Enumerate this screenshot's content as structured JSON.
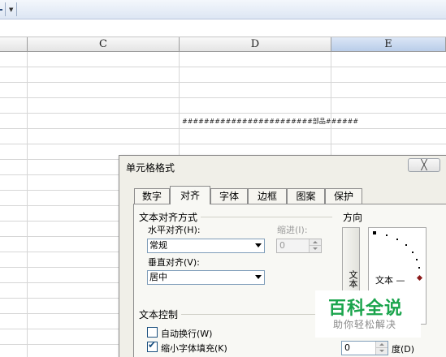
{
  "spreadsheet": {
    "columns": [
      "C",
      "D",
      "E"
    ],
    "selected_column": "E",
    "cell_text": "########################部品######"
  },
  "dialog": {
    "title": "单元格格式",
    "close_label": "╳",
    "tabs": [
      {
        "label": "数字"
      },
      {
        "label": "对齐"
      },
      {
        "label": "字体"
      },
      {
        "label": "边框"
      },
      {
        "label": "图案"
      },
      {
        "label": "保护"
      }
    ],
    "active_tab": "对齐",
    "alignment": {
      "group_label": "文本对齐方式",
      "horizontal_label": "水平对齐(H):",
      "horizontal_value": "常规",
      "indent_label": "缩进(I):",
      "indent_value": "0",
      "vertical_label": "垂直对齐(V):",
      "vertical_value": "居中"
    },
    "text_control": {
      "group_label": "文本控制",
      "wrap_label": "自动换行(W)",
      "wrap_checked": false,
      "shrink_label": "缩小字体填充(K)",
      "shrink_checked": true
    },
    "orientation": {
      "group_label": "方向",
      "vertical_text": "文本",
      "sample_text": "文本 —",
      "degrees_value": "0",
      "degrees_label": "度(D)"
    }
  },
  "watermark": {
    "main": "百科全说",
    "sub": "助你轻松解决"
  }
}
